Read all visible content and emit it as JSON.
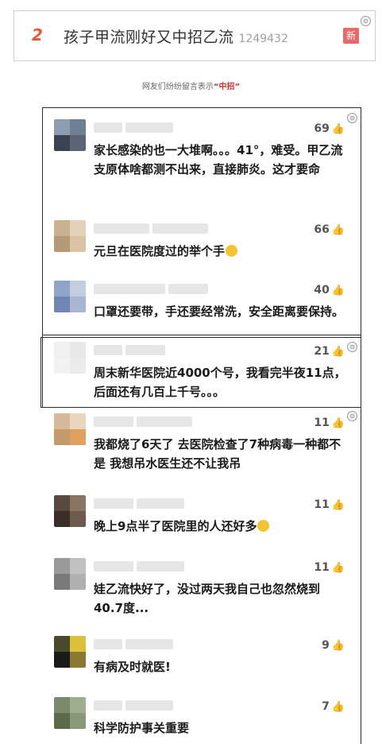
{
  "hot_search": {
    "rank": "2",
    "title": "孩子甲流刚好又中招乙流",
    "count": "1249432",
    "badge": "新"
  },
  "caption": {
    "prefix": "网友们纷纷留言表示",
    "highlight": "“中招”"
  },
  "comments": [
    {
      "likes": "69",
      "text": "家长感染的也一大堆啊。。。41°，难受。甲乙流支原体啥都测不出来，直接肺炎。这才要命"
    },
    {
      "likes": "66",
      "text": "元旦在医院度过的举个手"
    },
    {
      "likes": "40",
      "text": "口罩还要带，手还要经常洗，安全距离要保持。"
    },
    {
      "likes": "21",
      "text": "周末新华医院近4000个号，我看完半夜11点，后面还有几百上千号。。。"
    },
    {
      "likes": "11",
      "text": "我都烧了6天了 去医院检查了7种病毒一种都不是 我想吊水医生还不让我吊"
    },
    {
      "likes": "11",
      "text": "晚上9点半了医院里的人还好多"
    },
    {
      "likes": "11",
      "text": "娃乙流快好了，没过两天我自己也忽然烧到40.7度..."
    },
    {
      "likes": "9",
      "text": "有病及时就医!"
    },
    {
      "likes": "7",
      "text": "科学防护事关重要"
    }
  ],
  "icons": {
    "like": "thumbs-up-icon",
    "corner": "info-badge-icon"
  },
  "colors": {
    "rank": "#e8563a",
    "badge": "#ec6767",
    "highlight": "#d43030"
  }
}
